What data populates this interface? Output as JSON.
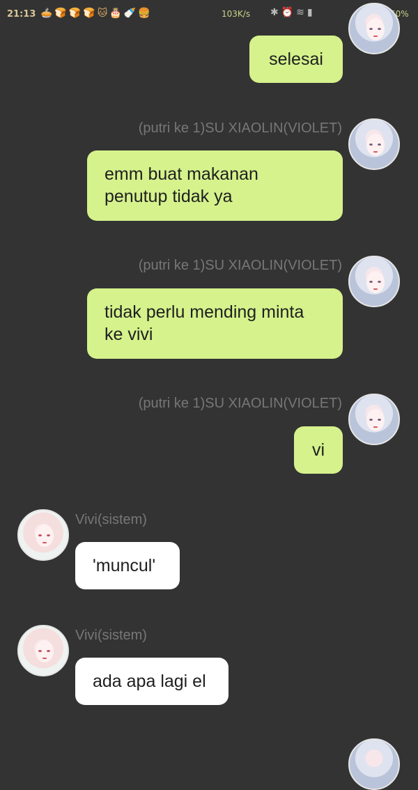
{
  "status_bar": {
    "time": "21:13",
    "network_speed": "103K/s",
    "battery": "60%"
  },
  "messages": [
    {
      "sender": "",
      "text": "selesai",
      "side": "right"
    },
    {
      "sender": "(putri ke 1)SU XIAOLIN(VIOLET)",
      "text": "emm buat makanan penutup tidak ya",
      "side": "right"
    },
    {
      "sender": "(putri ke 1)SU XIAOLIN(VIOLET)",
      "text": "tidak perlu mending minta ke vivi",
      "side": "right"
    },
    {
      "sender": "(putri ke 1)SU XIAOLIN(VIOLET)",
      "text": "vi",
      "side": "right"
    },
    {
      "sender": "Vivi(sistem)",
      "text": "'muncul'",
      "side": "left"
    },
    {
      "sender": "Vivi(sistem)",
      "text": "ada apa lagi el",
      "side": "left"
    }
  ]
}
